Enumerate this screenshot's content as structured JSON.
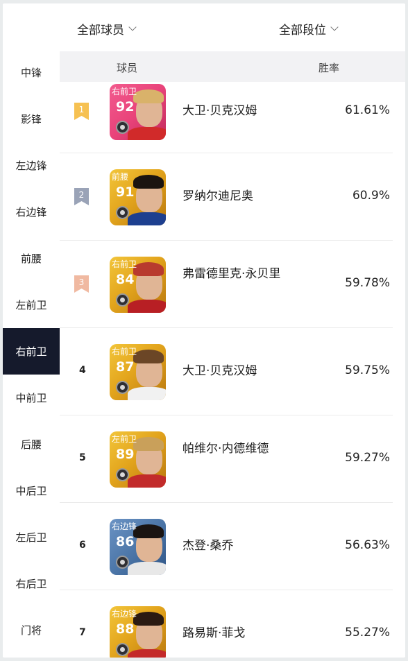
{
  "filters": {
    "players": "全部球员",
    "tiers": "全部段位"
  },
  "sidebar": {
    "items": [
      {
        "label": "中锋"
      },
      {
        "label": "影锋"
      },
      {
        "label": "左边锋"
      },
      {
        "label": "右边锋"
      },
      {
        "label": "前腰"
      },
      {
        "label": "左前卫"
      },
      {
        "label": "右前卫",
        "active": true
      },
      {
        "label": "中前卫"
      },
      {
        "label": "后腰"
      },
      {
        "label": "中后卫"
      },
      {
        "label": "左后卫"
      },
      {
        "label": "右后卫"
      },
      {
        "label": "门将"
      }
    ]
  },
  "table": {
    "headers": {
      "player": "球员",
      "win_rate": "胜率"
    },
    "rows": [
      {
        "rank": "1",
        "rank_style": "gold",
        "pos": "右前卫",
        "rating": "92",
        "name": "大卫·贝克汉姆",
        "rate": "61.61%",
        "card": "pink"
      },
      {
        "rank": "2",
        "rank_style": "silver",
        "pos": "前腰",
        "rating": "91",
        "name": "罗纳尔迪尼奥",
        "rate": "60.9%",
        "card": "gold"
      },
      {
        "rank": "3",
        "rank_style": "bronze",
        "pos": "右前卫",
        "rating": "84",
        "name": "弗雷德里克·永贝里",
        "rate": "59.78%",
        "card": "gold"
      },
      {
        "rank": "4",
        "rank_style": "plain",
        "pos": "右前卫",
        "rating": "87",
        "name": "大卫·贝克汉姆",
        "rate": "59.75%",
        "card": "gold"
      },
      {
        "rank": "5",
        "rank_style": "plain",
        "pos": "左前卫",
        "rating": "89",
        "name": "帕维尔·内德维德",
        "rate": "59.27%",
        "card": "gold"
      },
      {
        "rank": "6",
        "rank_style": "plain",
        "pos": "右边锋",
        "rating": "86",
        "name": "杰登·桑乔",
        "rate": "56.63%",
        "card": "blue"
      },
      {
        "rank": "7",
        "rank_style": "plain",
        "pos": "右边锋",
        "rating": "88",
        "name": "路易斯·菲戈",
        "rate": "55.27%",
        "card": "gold"
      }
    ]
  },
  "colors": {
    "gold_card": "#e3a51d",
    "pink_card": "#e9437a",
    "blue_card": "#4c76a8",
    "rank_gold": "#f6c152",
    "rank_silver": "#9aa3b7",
    "rank_bronze": "#f0b9a1",
    "active_bg": "#151a2c"
  }
}
